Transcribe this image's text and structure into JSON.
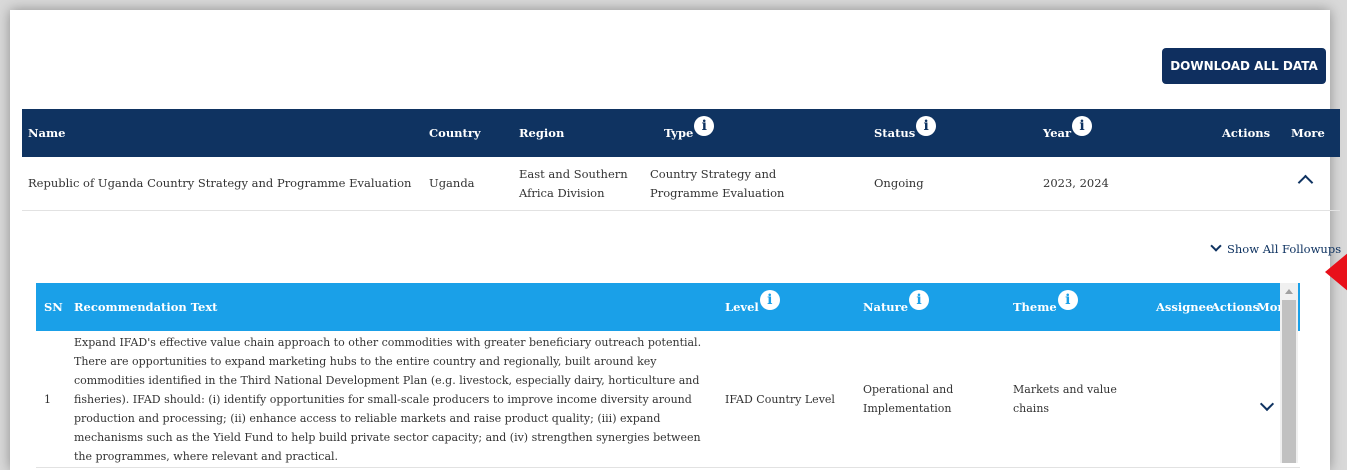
{
  "toolbar": {
    "download_label": "DOWNLOAD ALL DATA"
  },
  "main_table": {
    "headers": {
      "name": "Name",
      "country": "Country",
      "region": "Region",
      "type": "Type",
      "status": "Status",
      "year": "Year",
      "actions": "Actions",
      "more": "More"
    },
    "rows": [
      {
        "name": "Republic of Uganda Country Strategy and Programme Evaluation",
        "country": "Uganda",
        "region": "East and Southern Africa Division",
        "type": "Country Strategy and Programme Evaluation",
        "status": "Ongoing",
        "year": "2023, 2024"
      }
    ]
  },
  "followups": {
    "label": "Show All Followups"
  },
  "sub_table": {
    "headers": {
      "sn": "SN",
      "text": "Recommendation Text",
      "level": "Level",
      "nature": "Nature",
      "theme": "Theme",
      "assignee": "Assignee",
      "actions": "Actions",
      "more": "More"
    },
    "rows": [
      {
        "sn": "1",
        "text": "Expand IFAD's effective value chain approach to other commodities with greater beneficiary outreach potential. There are opportunities to expand marketing hubs to the entire country and regionally, built around key commodities identified in the Third National Development Plan (e.g. livestock, especially dairy, horticulture and fisheries). IFAD should: (i) identify opportunities for small-scale producers to improve income diversity around production and processing; (ii) enhance access to reliable markets and raise product quality; (iii) expand mechanisms such as the Yield Fund to help build private sector capacity; and (iv) strengthen synergies between the programmes, where relevant and practical.",
        "level": "IFAD Country Level",
        "nature": "Operational and Implementation",
        "theme": "Markets and value chains"
      }
    ]
  },
  "icons": {
    "info": "i"
  },
  "colors": {
    "navy": "#0f3361",
    "blue": "#1aa0e8",
    "arrow": "#e8101a"
  }
}
